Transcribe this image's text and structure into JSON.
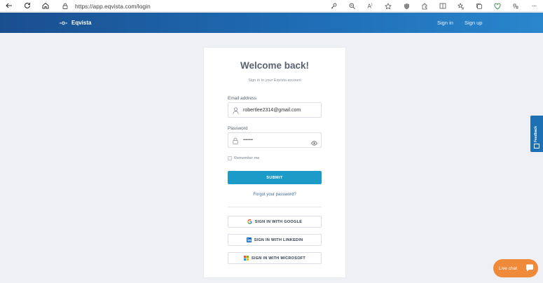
{
  "browser": {
    "url": "https://app.eqvista.com/login",
    "icons": [
      "back-icon",
      "refresh-icon",
      "home-icon",
      "lock-icon",
      "key-icon",
      "zoom-icon",
      "read-aloud-icon",
      "favorite-icon",
      "shield-icon",
      "extensions-icon",
      "split-screen-icon",
      "favorites-list-icon",
      "collections-icon",
      "performance-icon",
      "more-icon"
    ]
  },
  "header": {
    "brand": "Eqvista",
    "signin": "Sign in",
    "signup": "Sign up",
    "colors": {
      "from": "#1a4f8f",
      "to": "#2a86cc"
    }
  },
  "login": {
    "title": "Welcome back!",
    "subtitle": "Sign in to your Eqvista account",
    "email_label": "Email address",
    "email_value": "robertlee2314@gmail.com",
    "password_label": "Password",
    "password_value": "••••••••",
    "remember_label": "Remember me",
    "submit_label": "SUBMIT",
    "forgot_label": "Forgot your password?",
    "google_label": "SIGN IN WITH GOOGLE",
    "linkedin_label": "SIGN IN WITH LINKEDIN",
    "microsoft_label": "SIGN IN WITH MICROSOFT",
    "accent": "#1d9bc8"
  },
  "feedback": {
    "label": "Feedback"
  },
  "chat": {
    "label": "Live chat",
    "color": "#f08a3b"
  }
}
